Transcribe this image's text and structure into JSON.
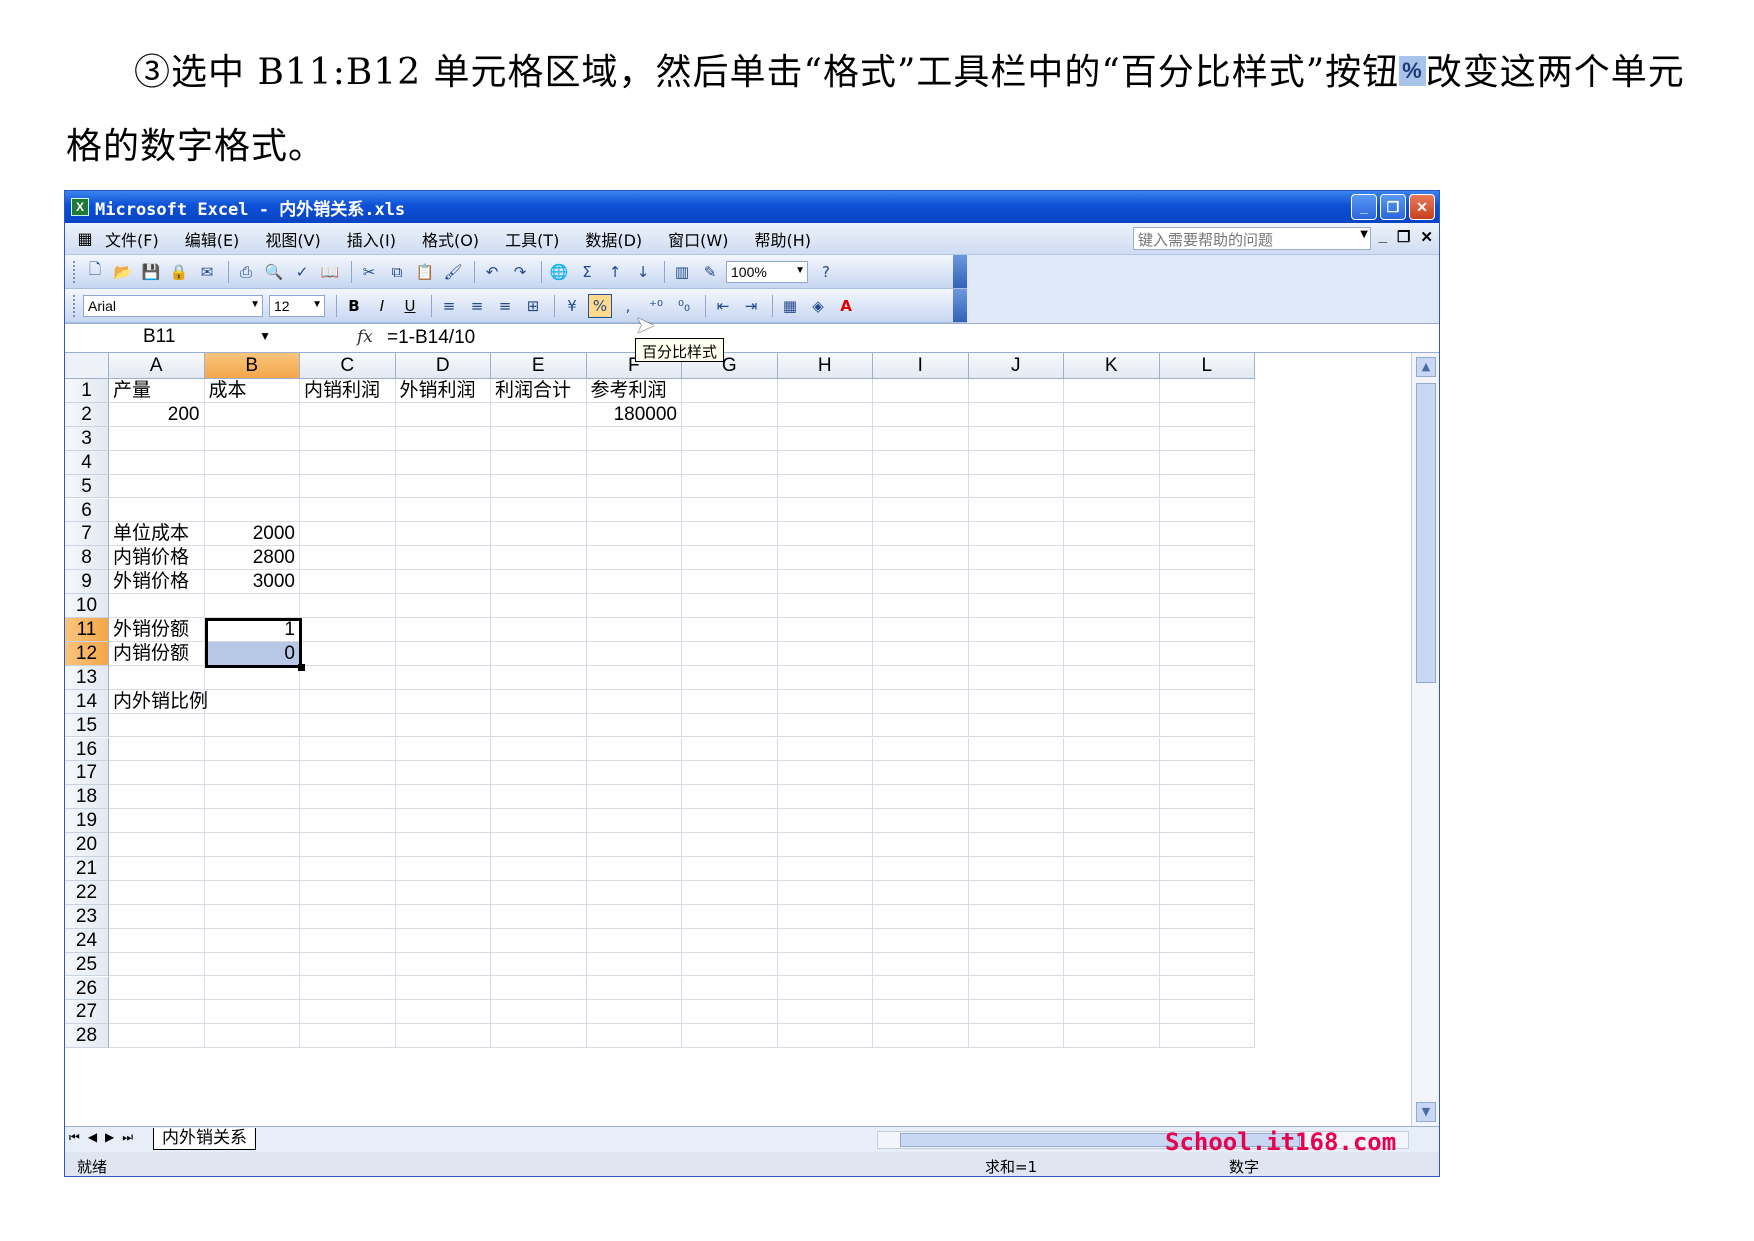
{
  "instruction": {
    "line1_before": "③选中 B11:B12 单元格区域，然后单击“格式”工具栏中的“百分比样式”按钮",
    "inline_icon": "%",
    "line1_after": "改变这两个单元格的数字格式。"
  },
  "window": {
    "title": "Microsoft Excel - 内外销关系.xls",
    "app_icon": "X"
  },
  "menu": {
    "items": [
      "文件(F)",
      "编辑(E)",
      "视图(V)",
      "插入(I)",
      "格式(O)",
      "工具(T)",
      "数据(D)",
      "窗口(W)",
      "帮助(H)"
    ],
    "help_placeholder": "键入需要帮助的问题"
  },
  "toolbar": {
    "zoom": "100%",
    "font_name": "Arial",
    "font_size": "12",
    "tooltip": "百分比样式"
  },
  "formula_bar": {
    "name_box": "B11",
    "fx": "fx",
    "formula": "=1-B14/10"
  },
  "grid": {
    "columns": [
      "A",
      "B",
      "C",
      "D",
      "E",
      "F",
      "G",
      "H",
      "I",
      "J",
      "K",
      "L"
    ],
    "active_column": "B",
    "rows": [
      {
        "n": "1",
        "A": "产量",
        "B": "成本",
        "C": "内销利润",
        "D": "外销利润",
        "E": "利润合计",
        "F": "参考利润"
      },
      {
        "n": "2",
        "A": "200",
        "F": "180000"
      },
      {
        "n": "3"
      },
      {
        "n": "4"
      },
      {
        "n": "5"
      },
      {
        "n": "6"
      },
      {
        "n": "7",
        "A": "单位成本",
        "B": "2000"
      },
      {
        "n": "8",
        "A": "内销价格",
        "B": "2800"
      },
      {
        "n": "9",
        "A": "外销价格",
        "B": "3000"
      },
      {
        "n": "10"
      },
      {
        "n": "11",
        "A": "外销份额",
        "B": "1",
        "active": true
      },
      {
        "n": "12",
        "A": "内销份额",
        "B": "0",
        "active": true
      },
      {
        "n": "13"
      },
      {
        "n": "14",
        "A": "内外销比例"
      },
      {
        "n": "15"
      },
      {
        "n": "16"
      },
      {
        "n": "17"
      },
      {
        "n": "18"
      },
      {
        "n": "19"
      },
      {
        "n": "20"
      },
      {
        "n": "21"
      },
      {
        "n": "22"
      },
      {
        "n": "23"
      },
      {
        "n": "24"
      },
      {
        "n": "25"
      },
      {
        "n": "26"
      },
      {
        "n": "27"
      },
      {
        "n": "28"
      }
    ]
  },
  "sheet_tab": "内外销关系",
  "status": {
    "left": "就绪",
    "sum": "求和=1",
    "mode": "数字"
  },
  "watermark": "School.it168.com"
}
